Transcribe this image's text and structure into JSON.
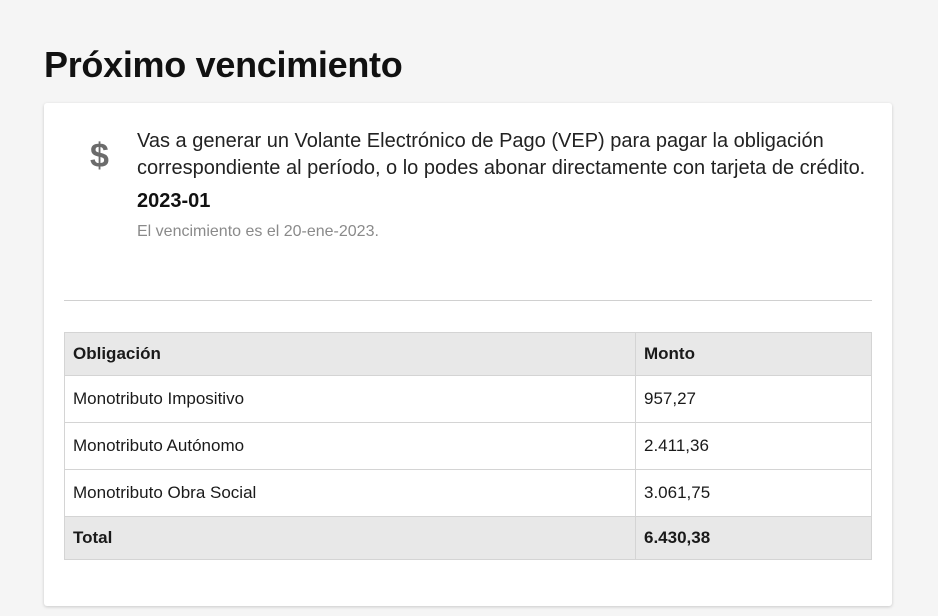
{
  "page": {
    "title": "Próximo vencimiento"
  },
  "info": {
    "icon": "dollar-icon",
    "description": "Vas a generar un Volante Electrónico de Pago (VEP) para pagar la obligación correspondiente al período, o lo podes abonar directamente con tarjeta de crédito.",
    "period": "2023-01",
    "due_note": "El vencimiento es el 20-ene-2023."
  },
  "table": {
    "headers": [
      "Obligación",
      "Monto"
    ],
    "rows": [
      {
        "obligation": "Monotributo Impositivo",
        "amount": "957,27"
      },
      {
        "obligation": "Monotributo Autónomo",
        "amount": "2.411,36"
      },
      {
        "obligation": "Monotributo Obra Social",
        "amount": "3.061,75"
      }
    ],
    "total": {
      "label": "Total",
      "amount": "6.430,38"
    }
  },
  "colors": {
    "background": "#f5f5f5",
    "card": "#ffffff",
    "table_header": "#e8e8e8",
    "icon": "#6b6b6b",
    "muted_text": "#8a8a8a"
  }
}
